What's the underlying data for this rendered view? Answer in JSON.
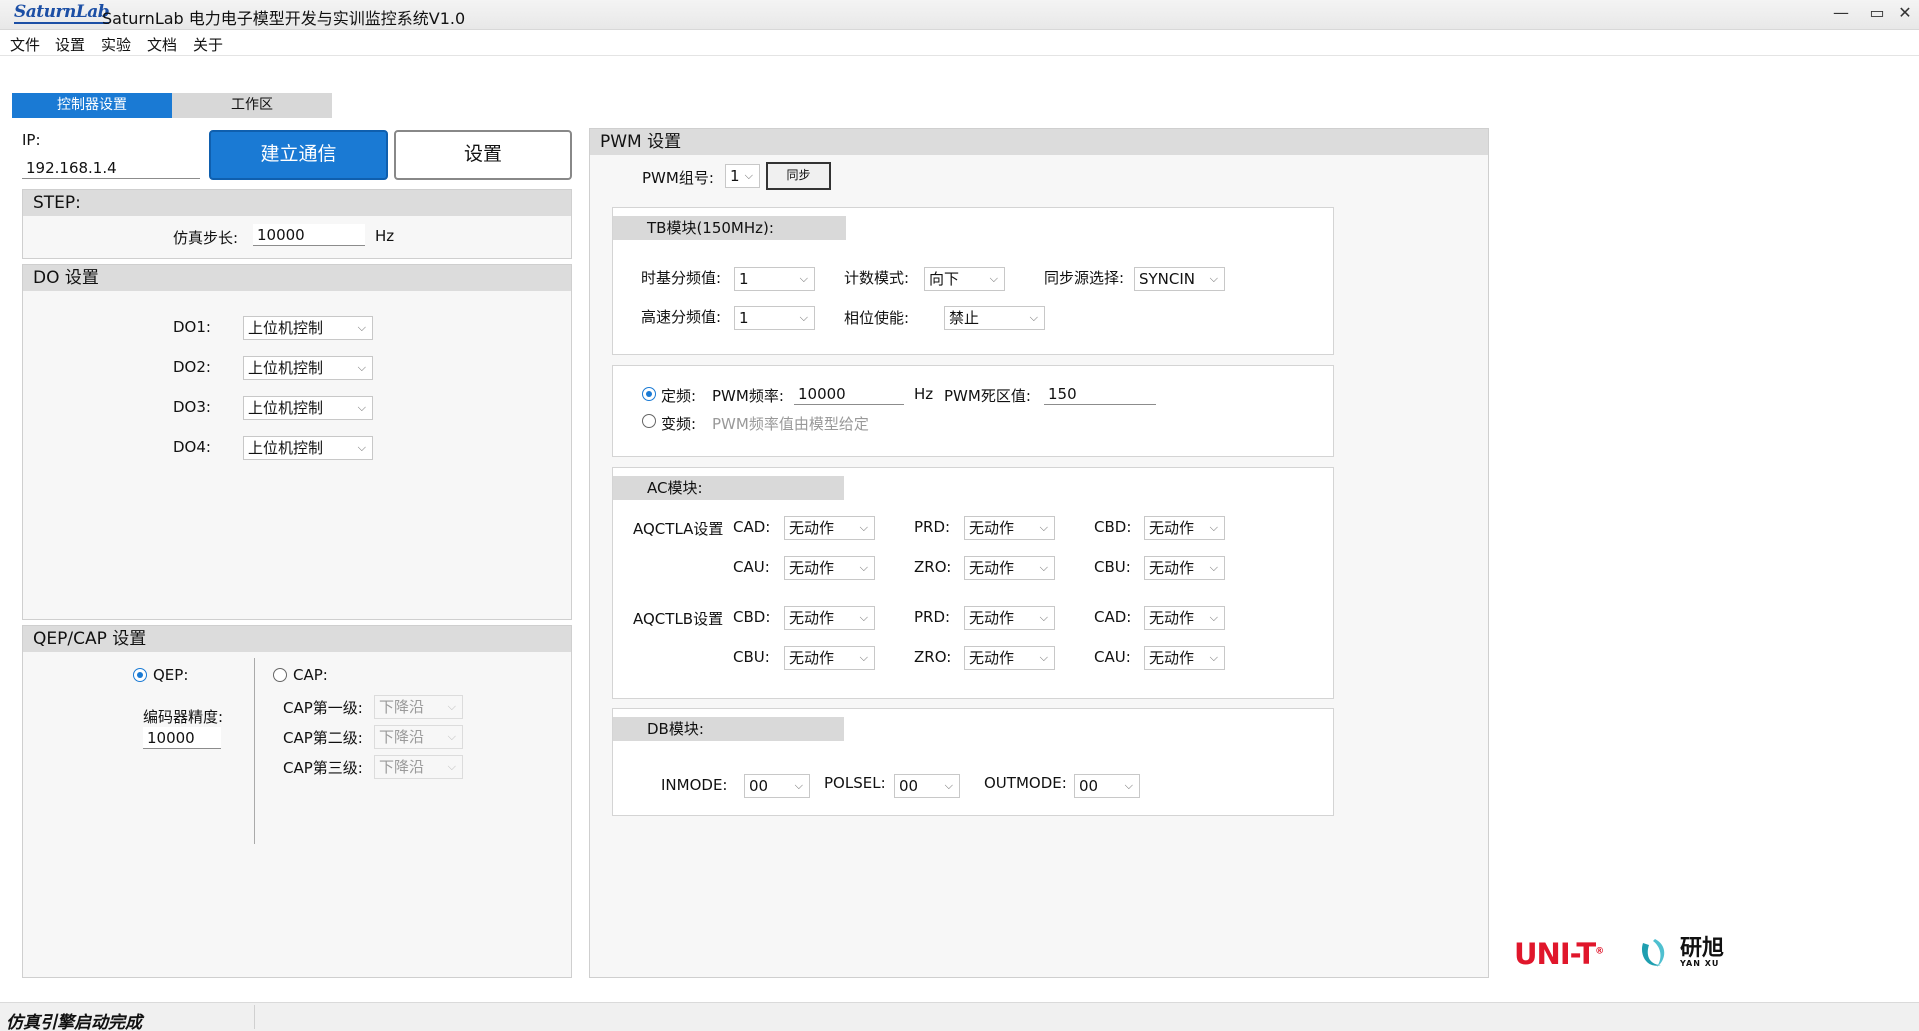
{
  "window": {
    "logo": "SaturnLab",
    "title": "SaturnLab 电力电子模型开发与实训监控系统V1.0",
    "controls": [
      "—",
      "▭",
      "✕"
    ]
  },
  "menu": [
    "文件",
    "设置",
    "实验",
    "文档",
    "关于"
  ],
  "tabs": [
    "控制器设置",
    "工作区"
  ],
  "ip": {
    "label": "IP:",
    "value": "192.168.1.4",
    "connect_button": "建立通信",
    "settings_button": "设置"
  },
  "step": {
    "title": "STEP:",
    "label": "仿真步长:",
    "value": "10000",
    "unit": "Hz"
  },
  "do_settings": {
    "title": "DO 设置",
    "items": [
      {
        "label": "DO1:",
        "value": "上位机控制"
      },
      {
        "label": "DO2:",
        "value": "上位机控制"
      },
      {
        "label": "DO3:",
        "value": "上位机控制"
      },
      {
        "label": "DO4:",
        "value": "上位机控制"
      }
    ]
  },
  "qep_cap": {
    "title": "QEP/CAP 设置",
    "qep_label": "QEP:",
    "cap_label": "CAP:",
    "encoder_label": "编码器精度:",
    "encoder_value": "10000",
    "cap_levels": [
      {
        "label": "CAP第一级:",
        "value": "下降沿"
      },
      {
        "label": "CAP第二级:",
        "value": "下降沿"
      },
      {
        "label": "CAP第三级:",
        "value": "下降沿"
      }
    ]
  },
  "pwm": {
    "title": "PWM 设置",
    "group_label": "PWM组号:",
    "group_value": "1",
    "sync_button": "同步",
    "tb": {
      "title": "TB模块(150MHz):",
      "timebase_div_label": "时基分频值:",
      "timebase_div_value": "1",
      "count_mode_label": "计数模式:",
      "count_mode_value": "向下",
      "sync_src_label": "同步源选择:",
      "sync_src_value": "SYNCIN",
      "hs_div_label": "高速分频值:",
      "hs_div_value": "1",
      "phase_en_label": "相位使能:",
      "phase_en_value": "禁止"
    },
    "freq": {
      "fixed_label": "定频:",
      "pwm_freq_label": "PWM频率:",
      "pwm_freq_value": "10000",
      "unit": "Hz",
      "deadband_label": "PWM死区值:",
      "deadband_value": "150",
      "variable_label": "变频:",
      "variable_note": "PWM频率值由模型给定"
    },
    "ac": {
      "title": "AC模块:",
      "aqctla_label": "AQCTLA设置",
      "aqctlb_label": "AQCTLB设置",
      "a_row1": [
        {
          "label": "CAD:",
          "value": "无动作"
        },
        {
          "label": "PRD:",
          "value": "无动作"
        },
        {
          "label": "CBD:",
          "value": "无动作"
        }
      ],
      "a_row2": [
        {
          "label": "CAU:",
          "value": "无动作"
        },
        {
          "label": "ZRO:",
          "value": "无动作"
        },
        {
          "label": "CBU:",
          "value": "无动作"
        }
      ],
      "b_row1": [
        {
          "label": "CBD:",
          "value": "无动作"
        },
        {
          "label": "PRD:",
          "value": "无动作"
        },
        {
          "label": "CAD:",
          "value": "无动作"
        }
      ],
      "b_row2": [
        {
          "label": "CBU:",
          "value": "无动作"
        },
        {
          "label": "ZRO:",
          "value": "无动作"
        },
        {
          "label": "CAU:",
          "value": "无动作"
        }
      ]
    },
    "db": {
      "title": "DB模块:",
      "inmode_label": "INMODE:",
      "inmode_value": "00",
      "polsel_label": "POLSEL:",
      "polsel_value": "00",
      "outmode_label": "OUTMODE:",
      "outmode_value": "00"
    }
  },
  "brand": {
    "unit_logo": "UNI-T",
    "unit_mark": "®",
    "yanxu_cn": "研旭",
    "yanxu_en": "YAN XU"
  },
  "status": "仿真引擎启动完成",
  "colors": {
    "accent": "#1a7ad4",
    "panel_header": "#dcdcdc",
    "unit_red": "#e0162b",
    "yanxu_teal": "#1f9fb0"
  }
}
